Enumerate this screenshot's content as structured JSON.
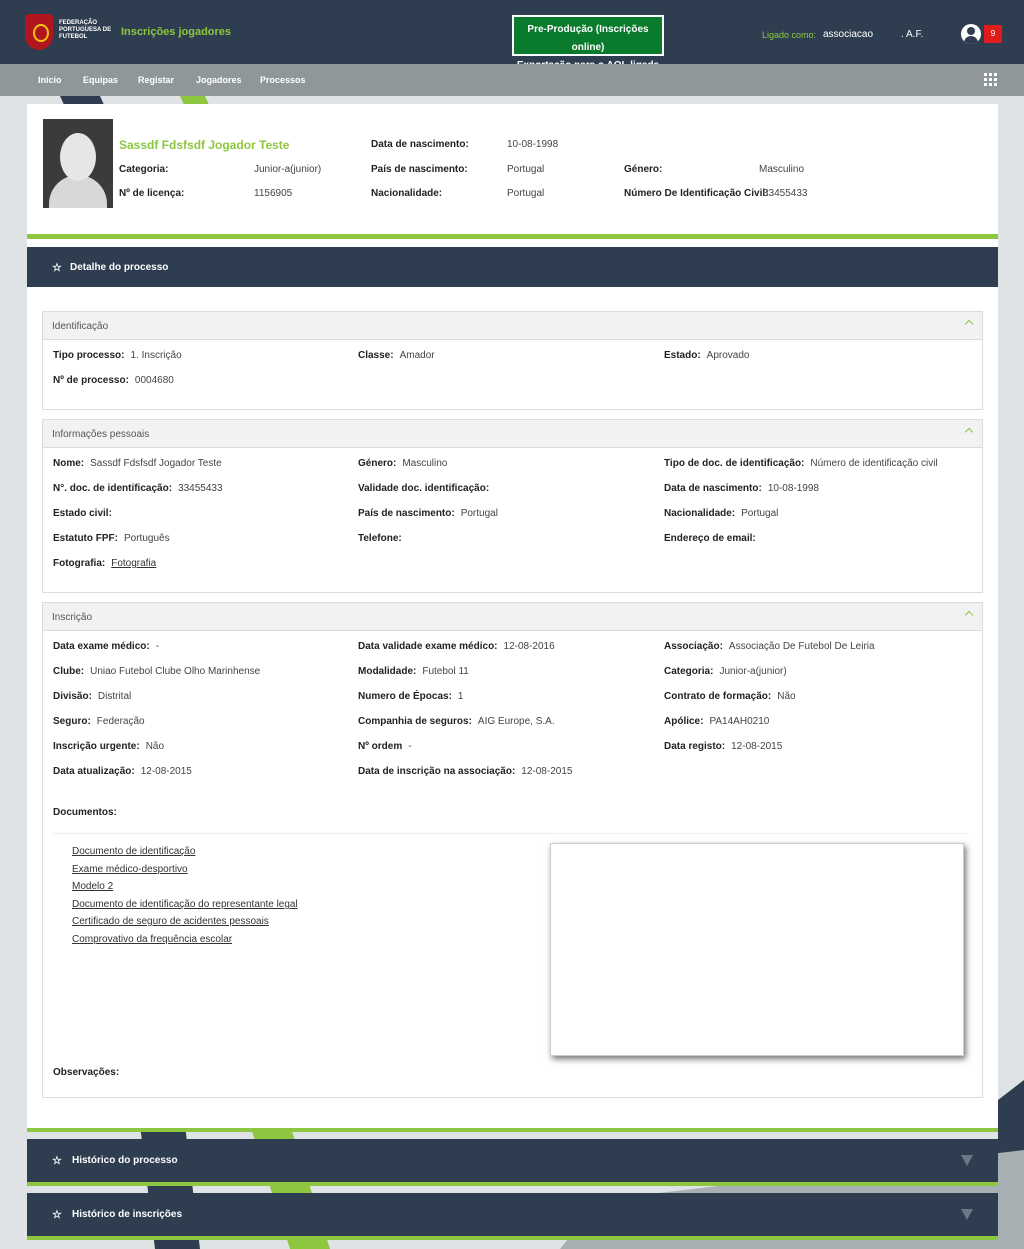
{
  "header": {
    "logo_text": "FEDERAÇÃO PORTUGUESA DE FUTEBOL",
    "app_title": "Inscrições jogadores",
    "env_line1": "Pre-Produção (Inscrições online)",
    "env_line2": "Exportação para o AOL ligada",
    "login_label": "Ligado como:",
    "login_user": "associacao",
    "login_org": ". A.F.",
    "notification_count": "9"
  },
  "nav": {
    "items": [
      "Início",
      "Equipas",
      "Registar",
      "Jogadores",
      "Processos"
    ]
  },
  "player": {
    "name": "Sassdf Fdsfsdf Jogador Teste",
    "categoria_label": "Categoria:",
    "categoria": "Junior-a(junior)",
    "licenca_label": "Nº de licença:",
    "licenca": "1156905",
    "nascimento_label": "Data de nascimento:",
    "nascimento": "10-08-1998",
    "pais_label": "País de nascimento:",
    "pais": "Portugal",
    "nacionalidade_label": "Nacionalidade:",
    "nacionalidade": "Portugal",
    "genero_label": "Género:",
    "genero": "Masculino",
    "nic_label": "Número De Identificação Civil:",
    "nic": "33455433"
  },
  "detail_title": "Detalhe do processo",
  "identificacao": {
    "title": "Identificação",
    "tipo_label": "Tipo processo:",
    "tipo": "1. Inscrição",
    "classe_label": "Classe:",
    "classe": "Amador",
    "estado_label": "Estado:",
    "estado": "Aprovado",
    "numero_label": "Nº de processo:",
    "numero": "0004680"
  },
  "pessoais": {
    "title": "Informações pessoais",
    "nome_label": "Nome:",
    "nome": "Sassdf Fdsfsdf Jogador Teste",
    "genero_label": "Género:",
    "genero": "Masculino",
    "tipodoc_label": "Tipo de doc. de identificação:",
    "tipodoc": "Número de identificação civil",
    "ndoc_label": "N°. doc. de identificação:",
    "ndoc": "33455433",
    "validade_label": "Validade doc. identificação:",
    "nasc_label": "Data de nascimento:",
    "nasc": "10-08-1998",
    "civil_label": "Estado civil:",
    "pais_label": "País de nascimento:",
    "pais": "Portugal",
    "nac_label": "Nacionalidade:",
    "nac": "Portugal",
    "fpf_label": "Estatuto FPF:",
    "fpf": "Português",
    "tel_label": "Telefone:",
    "email_label": "Endereço de email:",
    "foto_label": "Fotografia:",
    "foto": "Fotografia"
  },
  "inscricao": {
    "title": "Inscrição",
    "exame_label": "Data exame médico:",
    "exame": "-",
    "validade_label": "Data validade exame médico:",
    "validade": "12-08-2016",
    "assoc_label": "Associação:",
    "assoc": "Associação De Futebol De Leiria",
    "clube_label": "Clube:",
    "clube": "Uniao Futebol Clube Olho Marinhense",
    "modal_label": "Modalidade:",
    "modal": "Futebol 11",
    "cat_label": "Categoria:",
    "cat": "Junior-a(junior)",
    "div_label": "Divisão:",
    "div": "Distrital",
    "epocas_label": "Numero de Épocas:",
    "epocas": "1",
    "contrato_label": "Contrato de formação:",
    "contrato": "Não",
    "seguro_label": "Seguro:",
    "seguro": "Federação",
    "comp_label": "Companhia de seguros:",
    "comp": "AIG Europe, S.A.",
    "apolice_label": "Apólice:",
    "apolice": "PA14AH0210",
    "urgente_label": "Inscrição urgente:",
    "urgente": "Não",
    "ordem_label": "Nº ordem",
    "ordem": "-",
    "registo_label": "Data registo:",
    "registo": "12-08-2015",
    "atual_label": "Data atualização:",
    "atual": "12-08-2015",
    "dataassoc_label": "Data de inscrição na associação:",
    "dataassoc": "12-08-2015",
    "docs_label": "Documentos:",
    "docs": [
      "Documento de identificação",
      "Exame médico-desportivo",
      "Modelo 2",
      "Documento de identificação do representante legal",
      "Certificado de seguro de acidentes pessoais",
      "Comprovativo da frequência escolar"
    ],
    "obs_label": "Observações:"
  },
  "historico_processo": "Histórico do processo",
  "historico_inscricoes": "Histórico de inscrições",
  "colors": {
    "navy": "#2e3e50",
    "green": "#8dc63f",
    "gray_nav": "#8f9799"
  }
}
